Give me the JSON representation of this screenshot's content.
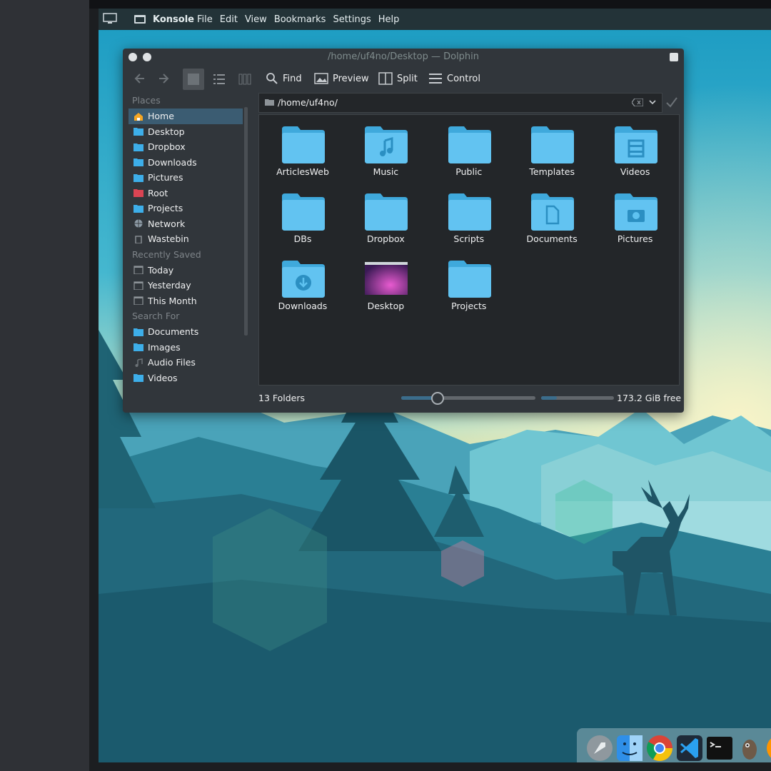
{
  "topbar": {
    "app_name": "Konsole",
    "menu": [
      "File",
      "Edit",
      "View",
      "Bookmarks",
      "Settings",
      "Help"
    ]
  },
  "window": {
    "title": "/home/uf4no/Desktop — Dolphin",
    "toolbar": {
      "find": "Find",
      "preview": "Preview",
      "split": "Split",
      "control": "Control"
    }
  },
  "places": {
    "heading": "Places",
    "items": [
      {
        "label": "Home",
        "icon": "home-icon"
      },
      {
        "label": "Desktop",
        "icon": "folder-icon"
      },
      {
        "label": "Dropbox",
        "icon": "folder-icon"
      },
      {
        "label": "Downloads",
        "icon": "folder-icon"
      },
      {
        "label": "Pictures",
        "icon": "folder-icon"
      },
      {
        "label": "Root",
        "icon": "root-folder-icon"
      },
      {
        "label": "Projects",
        "icon": "folder-icon"
      },
      {
        "label": "Network",
        "icon": "network-icon"
      },
      {
        "label": "Wastebin",
        "icon": "trash-icon"
      }
    ],
    "recent_heading": "Recently Saved",
    "recent": [
      {
        "label": "Today",
        "icon": "calendar-icon"
      },
      {
        "label": "Yesterday",
        "icon": "calendar-icon"
      },
      {
        "label": "This Month",
        "icon": "calendar-icon"
      }
    ],
    "search_heading": "Search For",
    "search": [
      {
        "label": "Documents",
        "icon": "folder-icon"
      },
      {
        "label": "Images",
        "icon": "folder-icon"
      },
      {
        "label": "Audio Files",
        "icon": "music-icon"
      },
      {
        "label": "Videos",
        "icon": "folder-icon"
      }
    ]
  },
  "location": {
    "path": "/home/uf4no/"
  },
  "files": [
    {
      "name": "ArticlesWeb",
      "icon": "folder-icon"
    },
    {
      "name": "Music",
      "icon": "music-folder-icon"
    },
    {
      "name": "Public",
      "icon": "folder-icon"
    },
    {
      "name": "Templates",
      "icon": "folder-icon"
    },
    {
      "name": "Videos",
      "icon": "video-folder-icon"
    },
    {
      "name": "DBs",
      "icon": "folder-icon"
    },
    {
      "name": "Dropbox",
      "icon": "folder-icon"
    },
    {
      "name": "Scripts",
      "icon": "folder-icon"
    },
    {
      "name": "Documents",
      "icon": "document-folder-icon"
    },
    {
      "name": "Pictures",
      "icon": "camera-folder-icon"
    },
    {
      "name": "Downloads",
      "icon": "download-folder-icon"
    },
    {
      "name": "Desktop",
      "icon": "desktop-folder-icon"
    },
    {
      "name": "Projects",
      "icon": "folder-icon"
    }
  ],
  "status": {
    "count": "13 Folders",
    "zoom_level": 0.27,
    "disk_used_fraction": 0.22,
    "free_space": "173.2 GiB free"
  },
  "dock": [
    "rocket-launcher-icon",
    "finder-icon",
    "chrome-icon",
    "vscode-icon",
    "terminal-icon",
    "gimp-icon",
    "firefox-icon"
  ],
  "colors": {
    "accent": "#3daee9",
    "folder": "#5ec2f0",
    "window_bg": "#31363b",
    "view_bg": "#232629"
  }
}
